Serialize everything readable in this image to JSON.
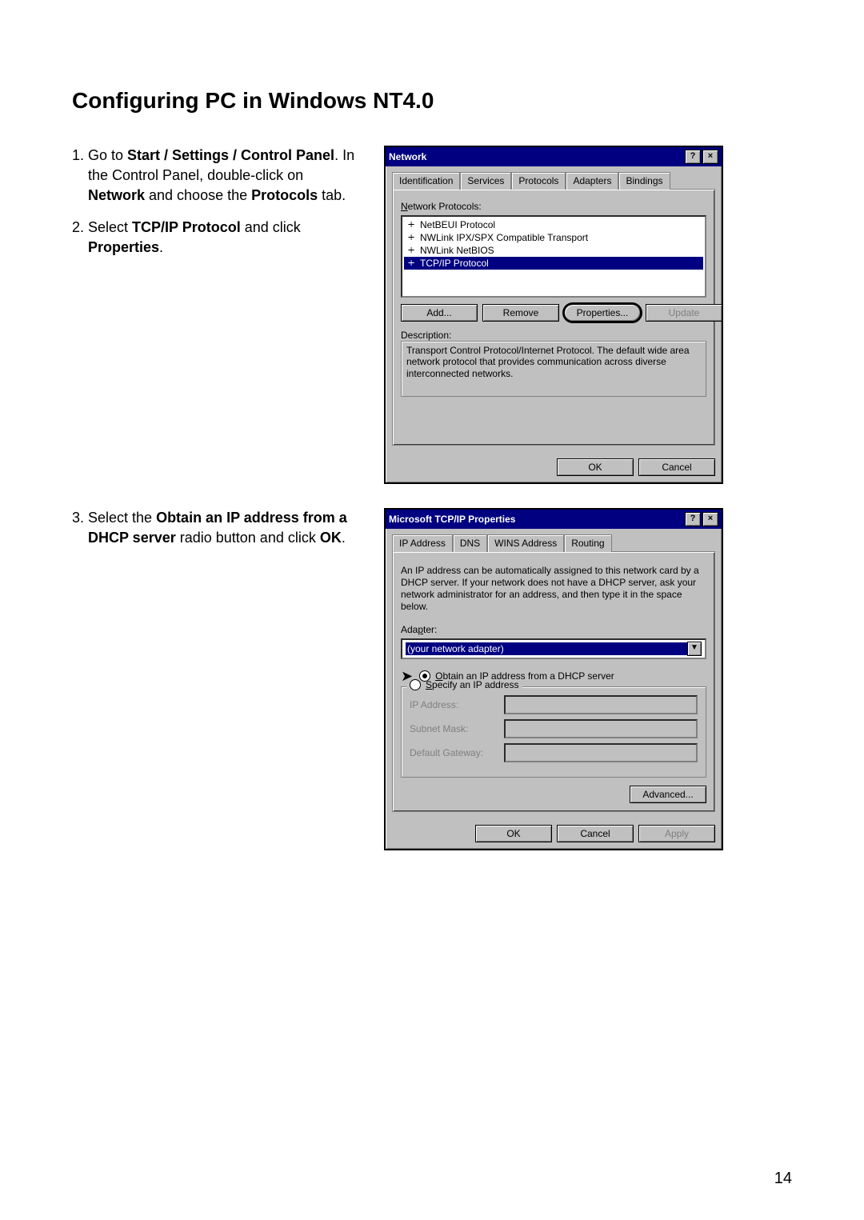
{
  "heading": "Configuring PC in Windows NT4.0",
  "step1": {
    "prefix": "Go to ",
    "path": "Start / Settings / Control Panel",
    "mid": ". In the Control Panel, double-click on ",
    "network": "Network",
    "mid2": " and choose the ",
    "protocols": "Protocols",
    "suffix": " tab."
  },
  "step2": {
    "prefix": "Select ",
    "tcpip": "TCP/IP Protocol",
    "mid": " and click ",
    "properties": "Properties",
    "suffix": "."
  },
  "step3": {
    "prefix": "Select the ",
    "obtain": "Obtain an IP address from a DHCP server",
    "mid": " radio button and click ",
    "ok": "OK",
    "suffix": "."
  },
  "page_number": "14",
  "dlg_network": {
    "title": "Network",
    "help_btn": "?",
    "close_btn": "×",
    "tabs": [
      "Identification",
      "Services",
      "Protocols",
      "Adapters",
      "Bindings"
    ],
    "list_label": "Network Protocols:",
    "protocols_list": [
      "NetBEUI Protocol",
      "NWLink IPX/SPX Compatible Transport",
      "NWLink NetBIOS",
      "TCP/IP Protocol"
    ],
    "btn_add": "Add...",
    "btn_remove": "Remove",
    "btn_properties": "Properties...",
    "btn_update": "Update",
    "desc_label": "Description:",
    "desc_text": "Transport Control Protocol/Internet Protocol. The default wide area network protocol that provides communication across diverse interconnected networks.",
    "btn_ok": "OK",
    "btn_cancel": "Cancel"
  },
  "dlg_tcpip": {
    "title": "Microsoft TCP/IP Properties",
    "help_btn": "?",
    "close_btn": "×",
    "tabs": [
      "IP Address",
      "DNS",
      "WINS Address",
      "Routing"
    ],
    "info": "An IP address can be automatically assigned to this network card by a DHCP server. If your network does not have a DHCP server, ask your network administrator for an address, and then type it in the space below.",
    "adapter_label": "Adapter:",
    "adapter_selected": "(your network adapter)",
    "radio_obtain": "Obtain an IP address from a DHCP server",
    "radio_specify": "Specify an IP address",
    "lbl_ip": "IP Address:",
    "lbl_subnet": "Subnet Mask:",
    "lbl_gateway": "Default Gateway:",
    "btn_advanced": "Advanced...",
    "btn_ok": "OK",
    "btn_cancel": "Cancel",
    "btn_apply": "Apply"
  }
}
